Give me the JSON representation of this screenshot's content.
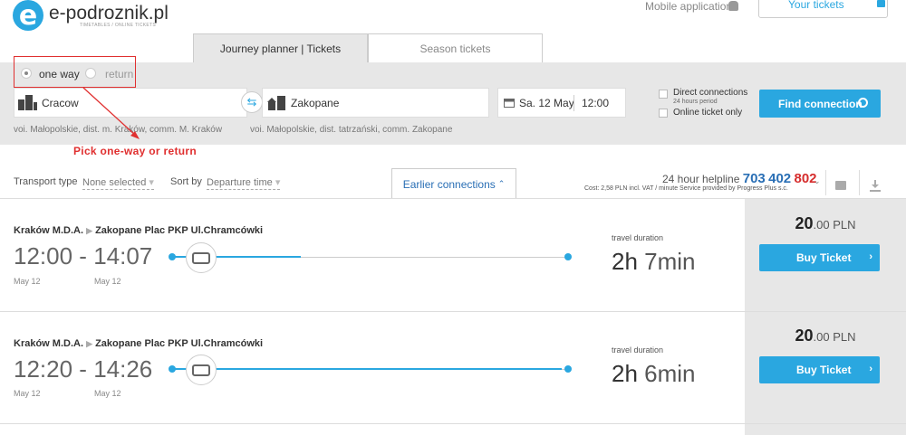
{
  "header": {
    "logo_letter": "e",
    "logo_text": "e-podroznik.pl",
    "logo_sub": "TIMETABLES / ONLINE TICKETS",
    "mobile_app": "Mobile application",
    "your_tickets": "Your tickets"
  },
  "tabs": [
    {
      "label": "Journey planner | Tickets"
    },
    {
      "label": "Season tickets"
    }
  ],
  "search": {
    "trip_types": [
      {
        "label": "one way"
      },
      {
        "label": "return"
      }
    ],
    "from": "Cracow",
    "to": "Zakopane",
    "date": "Sa. 12 May",
    "time": "12:00",
    "from_region": "voi. Małopolskie, dist. m. Kraków, comm. M. Kraków",
    "to_region": "voi. Małopolskie, dist. tatrzański, comm. Zakopane",
    "direct_label": "Direct connections",
    "direct_sub": "24 hours period",
    "online_label": "Online ticket only",
    "find_label": "Find connection"
  },
  "annotation": {
    "text": "Pick one-way or return"
  },
  "filters": {
    "transport_label": "Transport type",
    "transport_value": "None selected",
    "sort_label": "Sort by",
    "sort_value": "Departure time",
    "earlier": "Earlier connections"
  },
  "helpline": {
    "label": "24 hour helpline",
    "p1": "703",
    "p2": "402",
    "p3": "802",
    "cost": "Cost: 2,58 PLN incl. VAT / minute Service provided by Progress Plus s.c."
  },
  "results": [
    {
      "from": "Kraków M.D.A.",
      "to": "Zakopane Plac PKP Ul.Chramcówki",
      "depart": "12:00",
      "arrive": "14:07",
      "depart_date": "May 12",
      "arrive_date": "May 12",
      "duration_label": "travel duration",
      "dur_h": "2h",
      "dur_m": "7min",
      "price_int": "20",
      "price_rest": ".00 PLN",
      "buy_label": "Buy Ticket"
    },
    {
      "from": "Kraków M.D.A.",
      "to": "Zakopane Plac PKP Ul.Chramcówki",
      "depart": "12:20",
      "arrive": "14:26",
      "depart_date": "May 12",
      "arrive_date": "May 12",
      "duration_label": "travel duration",
      "dur_h": "2h",
      "dur_m": "6min",
      "price_int": "20",
      "price_rest": ".00 PLN",
      "buy_label": "Buy Ticket"
    }
  ],
  "colors": {
    "accent": "#2aa7e0",
    "annotation": "#e03030",
    "panel": "#e7e7e7"
  }
}
